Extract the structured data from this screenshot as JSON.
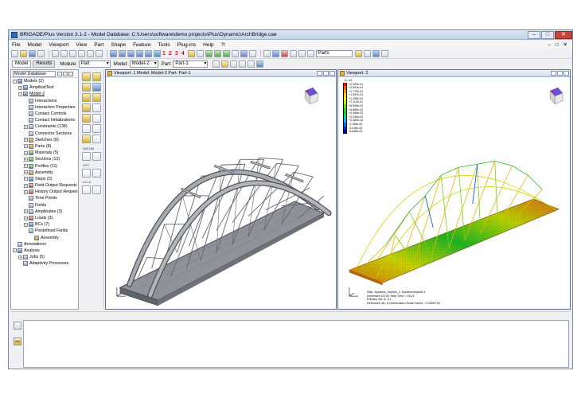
{
  "window": {
    "title": "BRIGADE/Plus Version 3.1-2 - Model Database: C:\\Users\\software\\demo projects\\Plus\\Dynamic\\ArchBridge.cae",
    "controls": [
      "–",
      "□",
      "✕"
    ]
  },
  "menu": {
    "items": [
      "File",
      "Model",
      "Viewport",
      "View",
      "Part",
      "Shape",
      "Feature",
      "Tools",
      "Plug-ins",
      "Help",
      "?!"
    ],
    "right": "– □ ✕"
  },
  "toolbar": {
    "numbers": [
      "1",
      "2",
      "3",
      "4"
    ],
    "parts_combo": "Parts"
  },
  "module_bar": {
    "tab_model": "Model",
    "tab_results": "Results",
    "module_label": "Module:",
    "module_value": "Part",
    "model_label": "Model:",
    "model_value": "Model-2",
    "part_label": "Part:",
    "part_value": "Part-1"
  },
  "tree": {
    "header_combo": "Model Database",
    "rows": [
      {
        "label": "Models (2)",
        "level": 0,
        "exp": "-",
        "icon": "blue",
        "iconName": "models-icon"
      },
      {
        "label": "AmplitudTest",
        "level": 1,
        "exp": "+",
        "icon": "blue",
        "iconName": "model-icon"
      },
      {
        "label": "Model-2",
        "level": 1,
        "exp": "-",
        "icon": "blue",
        "iconName": "model-icon",
        "underline": true
      },
      {
        "label": "Interactions",
        "level": 2,
        "exp": "",
        "icon": "gry",
        "iconName": "interactions-icon"
      },
      {
        "label": "Interaction Properties",
        "level": 2,
        "exp": "",
        "icon": "gry",
        "iconName": "interaction-properties-icon"
      },
      {
        "label": "Contact Controls",
        "level": 2,
        "exp": "",
        "icon": "gry",
        "iconName": "contact-controls-icon"
      },
      {
        "label": "Contact Initializations",
        "level": 2,
        "exp": "",
        "icon": "gry",
        "iconName": "contact-initializations-icon"
      },
      {
        "label": "Constraints (138)",
        "level": 2,
        "exp": "+",
        "icon": "gry",
        "iconName": "constraints-icon"
      },
      {
        "label": "Connector Sections",
        "level": 2,
        "exp": "",
        "icon": "gry",
        "iconName": "connector-sections-icon"
      },
      {
        "label": "Sketches (8)",
        "level": 2,
        "exp": "+",
        "icon": "yel",
        "iconName": "sketches-icon"
      },
      {
        "label": "Parts (8)",
        "level": 2,
        "exp": "+",
        "icon": "yel",
        "iconName": "parts-icon"
      },
      {
        "label": "Materials (5)",
        "level": 2,
        "exp": "+",
        "icon": "grn",
        "iconName": "materials-icon"
      },
      {
        "label": "Sections (13)",
        "level": 2,
        "exp": "+",
        "icon": "grn",
        "iconName": "sections-icon"
      },
      {
        "label": "Profiles (11)",
        "level": 2,
        "exp": "+",
        "icon": "grn",
        "iconName": "profiles-icon"
      },
      {
        "label": "Assembly",
        "level": 2,
        "exp": "+",
        "icon": "yel",
        "iconName": "assembly-icon"
      },
      {
        "label": "Steps (5)",
        "level": 2,
        "exp": "+",
        "icon": "blue",
        "iconName": "steps-icon"
      },
      {
        "label": "Field Output Requests (2)",
        "level": 2,
        "exp": "+",
        "icon": "red",
        "iconName": "field-output-icon"
      },
      {
        "label": "History Output Requests (",
        "level": 2,
        "exp": "+",
        "icon": "red",
        "iconName": "history-output-icon"
      },
      {
        "label": "Time Points",
        "level": 2,
        "exp": "",
        "icon": "gry",
        "iconName": "time-points-icon"
      },
      {
        "label": "Fields",
        "level": 2,
        "exp": "",
        "icon": "gry",
        "iconName": "fields-icon"
      },
      {
        "label": "Amplitudes (3)",
        "level": 2,
        "exp": "+",
        "icon": "gry",
        "iconName": "amplitudes-icon"
      },
      {
        "label": "Loads (3)",
        "level": 2,
        "exp": "+",
        "icon": "red",
        "iconName": "loads-icon"
      },
      {
        "label": "BCs (7)",
        "level": 2,
        "exp": "+",
        "icon": "blue",
        "iconName": "bcs-icon"
      },
      {
        "label": "Predefined Fields",
        "level": 2,
        "exp": "",
        "icon": "gry",
        "iconName": "predefined-fields-icon"
      },
      {
        "label": "Assembly",
        "level": 3,
        "exp": "",
        "icon": "yel",
        "iconName": "assembly-icon"
      },
      {
        "label": "Annotations",
        "level": 0,
        "exp": "",
        "icon": "gry",
        "iconName": "annotations-icon"
      },
      {
        "label": "Analysis",
        "level": 0,
        "exp": "-",
        "icon": "blue",
        "iconName": "analysis-icon"
      },
      {
        "label": "Jobs (5)",
        "level": 1,
        "exp": "+",
        "icon": "gry",
        "iconName": "jobs-icon"
      },
      {
        "label": "Adaptivity Processes",
        "level": 1,
        "exp": "",
        "icon": "gry",
        "iconName": "adaptivity-icon"
      }
    ]
  },
  "toolbox": {
    "labels": [
      "DATUM",
      "XYZ",
      "L1 L2"
    ]
  },
  "viewport1": {
    "title": "Viewport: 1   Model: Model-2   Part: Part-1"
  },
  "viewport2": {
    "title": "Viewport: 2",
    "legend_title": "A, U1",
    "legend": [
      {
        "val": "+2.223e-01",
        "color": "#ff0000"
      },
      {
        "val": "+2.001e-01",
        "color": "#ff5a00"
      },
      {
        "val": "+1.779e-01",
        "color": "#ff9a00"
      },
      {
        "val": "+1.557e-01",
        "color": "#ffd000"
      },
      {
        "val": "+1.335e-01",
        "color": "#f2f200"
      },
      {
        "val": "+1.113e-01",
        "color": "#b4ee00"
      },
      {
        "val": "+8.906e-02",
        "color": "#6edc00"
      },
      {
        "val": "+6.685e-02",
        "color": "#22d800"
      },
      {
        "val": "+4.465e-02",
        "color": "#00d84a"
      },
      {
        "val": "+2.245e-02",
        "color": "#00d8b0"
      },
      {
        "val": "+2.483e-04",
        "color": "#00b8ee"
      },
      {
        "val": "-2.196e-02",
        "color": "#0070ee"
      },
      {
        "val": "-4.416e-02",
        "color": "#0024e6"
      },
      {
        "val": "-6.636e-02",
        "color": "#0000b4"
      }
    ],
    "info_lines": [
      "Step: Dynamic_Implicit_1, Dynamic/Implicit 1",
      "Increment   10726: Step Time =    28.21",
      "Primary Var: A, U1",
      "Deformed Var: U   Deformation Scale Factor: +1.000e+00"
    ]
  },
  "colors": {
    "window_border": "#7a8aa8",
    "steel": "#8c9095",
    "deck": "#8f9399"
  }
}
